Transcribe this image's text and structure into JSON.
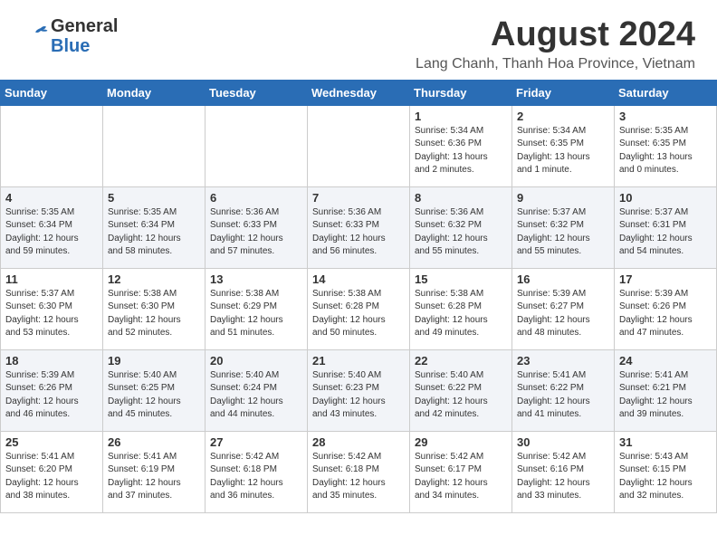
{
  "header": {
    "logo_general": "General",
    "logo_blue": "Blue",
    "month_year": "August 2024",
    "location": "Lang Chanh, Thanh Hoa Province, Vietnam"
  },
  "days_of_week": [
    "Sunday",
    "Monday",
    "Tuesday",
    "Wednesday",
    "Thursday",
    "Friday",
    "Saturday"
  ],
  "weeks": [
    [
      {
        "day": "",
        "info": ""
      },
      {
        "day": "",
        "info": ""
      },
      {
        "day": "",
        "info": ""
      },
      {
        "day": "",
        "info": ""
      },
      {
        "day": "1",
        "info": "Sunrise: 5:34 AM\nSunset: 6:36 PM\nDaylight: 13 hours\nand 2 minutes."
      },
      {
        "day": "2",
        "info": "Sunrise: 5:34 AM\nSunset: 6:35 PM\nDaylight: 13 hours\nand 1 minute."
      },
      {
        "day": "3",
        "info": "Sunrise: 5:35 AM\nSunset: 6:35 PM\nDaylight: 13 hours\nand 0 minutes."
      }
    ],
    [
      {
        "day": "4",
        "info": "Sunrise: 5:35 AM\nSunset: 6:34 PM\nDaylight: 12 hours\nand 59 minutes."
      },
      {
        "day": "5",
        "info": "Sunrise: 5:35 AM\nSunset: 6:34 PM\nDaylight: 12 hours\nand 58 minutes."
      },
      {
        "day": "6",
        "info": "Sunrise: 5:36 AM\nSunset: 6:33 PM\nDaylight: 12 hours\nand 57 minutes."
      },
      {
        "day": "7",
        "info": "Sunrise: 5:36 AM\nSunset: 6:33 PM\nDaylight: 12 hours\nand 56 minutes."
      },
      {
        "day": "8",
        "info": "Sunrise: 5:36 AM\nSunset: 6:32 PM\nDaylight: 12 hours\nand 55 minutes."
      },
      {
        "day": "9",
        "info": "Sunrise: 5:37 AM\nSunset: 6:32 PM\nDaylight: 12 hours\nand 55 minutes."
      },
      {
        "day": "10",
        "info": "Sunrise: 5:37 AM\nSunset: 6:31 PM\nDaylight: 12 hours\nand 54 minutes."
      }
    ],
    [
      {
        "day": "11",
        "info": "Sunrise: 5:37 AM\nSunset: 6:30 PM\nDaylight: 12 hours\nand 53 minutes."
      },
      {
        "day": "12",
        "info": "Sunrise: 5:38 AM\nSunset: 6:30 PM\nDaylight: 12 hours\nand 52 minutes."
      },
      {
        "day": "13",
        "info": "Sunrise: 5:38 AM\nSunset: 6:29 PM\nDaylight: 12 hours\nand 51 minutes."
      },
      {
        "day": "14",
        "info": "Sunrise: 5:38 AM\nSunset: 6:28 PM\nDaylight: 12 hours\nand 50 minutes."
      },
      {
        "day": "15",
        "info": "Sunrise: 5:38 AM\nSunset: 6:28 PM\nDaylight: 12 hours\nand 49 minutes."
      },
      {
        "day": "16",
        "info": "Sunrise: 5:39 AM\nSunset: 6:27 PM\nDaylight: 12 hours\nand 48 minutes."
      },
      {
        "day": "17",
        "info": "Sunrise: 5:39 AM\nSunset: 6:26 PM\nDaylight: 12 hours\nand 47 minutes."
      }
    ],
    [
      {
        "day": "18",
        "info": "Sunrise: 5:39 AM\nSunset: 6:26 PM\nDaylight: 12 hours\nand 46 minutes."
      },
      {
        "day": "19",
        "info": "Sunrise: 5:40 AM\nSunset: 6:25 PM\nDaylight: 12 hours\nand 45 minutes."
      },
      {
        "day": "20",
        "info": "Sunrise: 5:40 AM\nSunset: 6:24 PM\nDaylight: 12 hours\nand 44 minutes."
      },
      {
        "day": "21",
        "info": "Sunrise: 5:40 AM\nSunset: 6:23 PM\nDaylight: 12 hours\nand 43 minutes."
      },
      {
        "day": "22",
        "info": "Sunrise: 5:40 AM\nSunset: 6:22 PM\nDaylight: 12 hours\nand 42 minutes."
      },
      {
        "day": "23",
        "info": "Sunrise: 5:41 AM\nSunset: 6:22 PM\nDaylight: 12 hours\nand 41 minutes."
      },
      {
        "day": "24",
        "info": "Sunrise: 5:41 AM\nSunset: 6:21 PM\nDaylight: 12 hours\nand 39 minutes."
      }
    ],
    [
      {
        "day": "25",
        "info": "Sunrise: 5:41 AM\nSunset: 6:20 PM\nDaylight: 12 hours\nand 38 minutes."
      },
      {
        "day": "26",
        "info": "Sunrise: 5:41 AM\nSunset: 6:19 PM\nDaylight: 12 hours\nand 37 minutes."
      },
      {
        "day": "27",
        "info": "Sunrise: 5:42 AM\nSunset: 6:18 PM\nDaylight: 12 hours\nand 36 minutes."
      },
      {
        "day": "28",
        "info": "Sunrise: 5:42 AM\nSunset: 6:18 PM\nDaylight: 12 hours\nand 35 minutes."
      },
      {
        "day": "29",
        "info": "Sunrise: 5:42 AM\nSunset: 6:17 PM\nDaylight: 12 hours\nand 34 minutes."
      },
      {
        "day": "30",
        "info": "Sunrise: 5:42 AM\nSunset: 6:16 PM\nDaylight: 12 hours\nand 33 minutes."
      },
      {
        "day": "31",
        "info": "Sunrise: 5:43 AM\nSunset: 6:15 PM\nDaylight: 12 hours\nand 32 minutes."
      }
    ]
  ]
}
